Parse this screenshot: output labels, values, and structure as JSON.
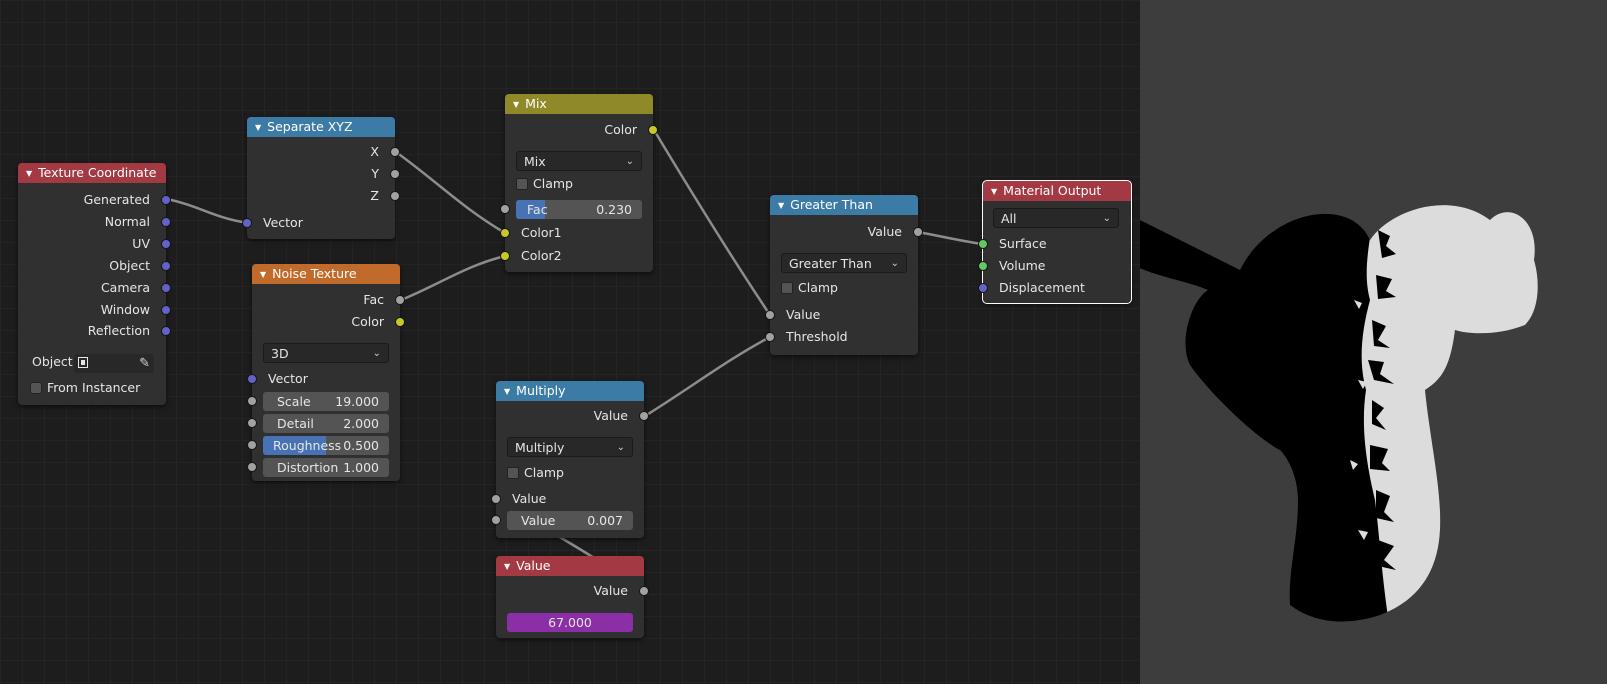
{
  "nodes": {
    "texture_coordinate": {
      "title": "Texture Coordinate",
      "outputs": [
        "Generated",
        "Normal",
        "UV",
        "Object",
        "Camera",
        "Window",
        "Reflection"
      ],
      "object_label": "Object:",
      "from_instancer": "From Instancer"
    },
    "separate_xyz": {
      "title": "Separate XYZ",
      "outputs": [
        "X",
        "Y",
        "Z"
      ],
      "input": "Vector"
    },
    "noise_texture": {
      "title": "Noise Texture",
      "outputs": [
        "Fac",
        "Color"
      ],
      "dimension": "3D",
      "input": "Vector",
      "fields": [
        {
          "label": "Scale",
          "value": "19.000"
        },
        {
          "label": "Detail",
          "value": "2.000"
        },
        {
          "label": "Roughness",
          "value": "0.500",
          "fill": 0.5
        },
        {
          "label": "Distortion",
          "value": "1.000"
        }
      ]
    },
    "mix": {
      "title": "Mix",
      "output": "Color",
      "blend_mode": "Mix",
      "clamp": "Clamp",
      "fac_label": "Fac",
      "fac_value": "0.230",
      "fac_fill": 0.23,
      "inputs": [
        "Color1",
        "Color2"
      ]
    },
    "greater_than": {
      "title": "Greater Than",
      "output": "Value",
      "operation": "Greater Than",
      "clamp": "Clamp",
      "inputs": [
        "Value",
        "Threshold"
      ]
    },
    "material_output": {
      "title": "Material Output",
      "target": "All",
      "inputs": [
        "Surface",
        "Volume",
        "Displacement"
      ]
    },
    "multiply": {
      "title": "Multiply",
      "output": "Value",
      "operation": "Multiply",
      "clamp": "Clamp",
      "input": "Value",
      "field_label": "Value",
      "field_value": "0.007"
    },
    "value": {
      "title": "Value",
      "output": "Value",
      "number": "67.000"
    }
  },
  "colors": {
    "header_input": "#a33a43",
    "header_converter": "#3c7ba6",
    "header_texture": "#c06b2b",
    "header_color": "#8f8a27",
    "socket_vector": "#6363c7",
    "socket_float": "#a1a1a1",
    "socket_color": "#c7c729",
    "socket_shader": "#63c763",
    "slider_fill": "#4772b3",
    "value_field": "#8a2fa6",
    "preview_bg": "#3d3d3d"
  },
  "icons": {
    "object_field": "cube-icon",
    "object_picker": "eyedropper-icon",
    "collapse": "triangle-down-icon",
    "dropdown": "chevron-down-icon"
  }
}
